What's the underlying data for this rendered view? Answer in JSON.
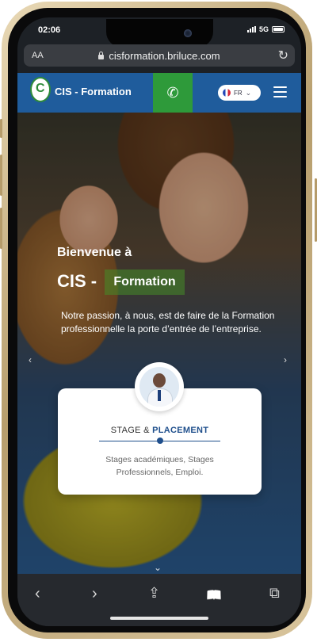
{
  "status_bar": {
    "time": "02:06",
    "network": "5G"
  },
  "browser": {
    "aa_label": "AA",
    "url": "cisformation.briluce.com"
  },
  "site_nav": {
    "brand": "CIS - Formation",
    "logo_letter": "C",
    "language": "FR"
  },
  "hero": {
    "welcome": "Bienvenue à",
    "title_prefix": "CIS -",
    "title_highlight": "Formation",
    "tagline": "Notre passion, à nous, est de faire de la Formation professionnelle la porte d’entrée de l’entreprise.",
    "prev_arrow": "‹",
    "next_arrow": "›"
  },
  "card": {
    "title_part1": "STAGE &",
    "title_part2": "PLACEMENT",
    "description": "Stages académiques, Stages Professionnels, Emploi."
  },
  "icons": {
    "phone": "phone-icon",
    "lock": "lock-icon",
    "reload": "reload-icon",
    "menu": "hamburger-icon",
    "scroll": "double-chevron-down-icon"
  },
  "colors": {
    "nav_blue": "#1f5c9c",
    "phone_green": "#2e9a3a",
    "accent_blue": "#1f4f8c",
    "highlight_green": "#468c28"
  },
  "toolbar": {
    "back": "‹",
    "forward": "›",
    "share": "⇪",
    "bookmarks": "📖",
    "tabs": "⧉"
  }
}
